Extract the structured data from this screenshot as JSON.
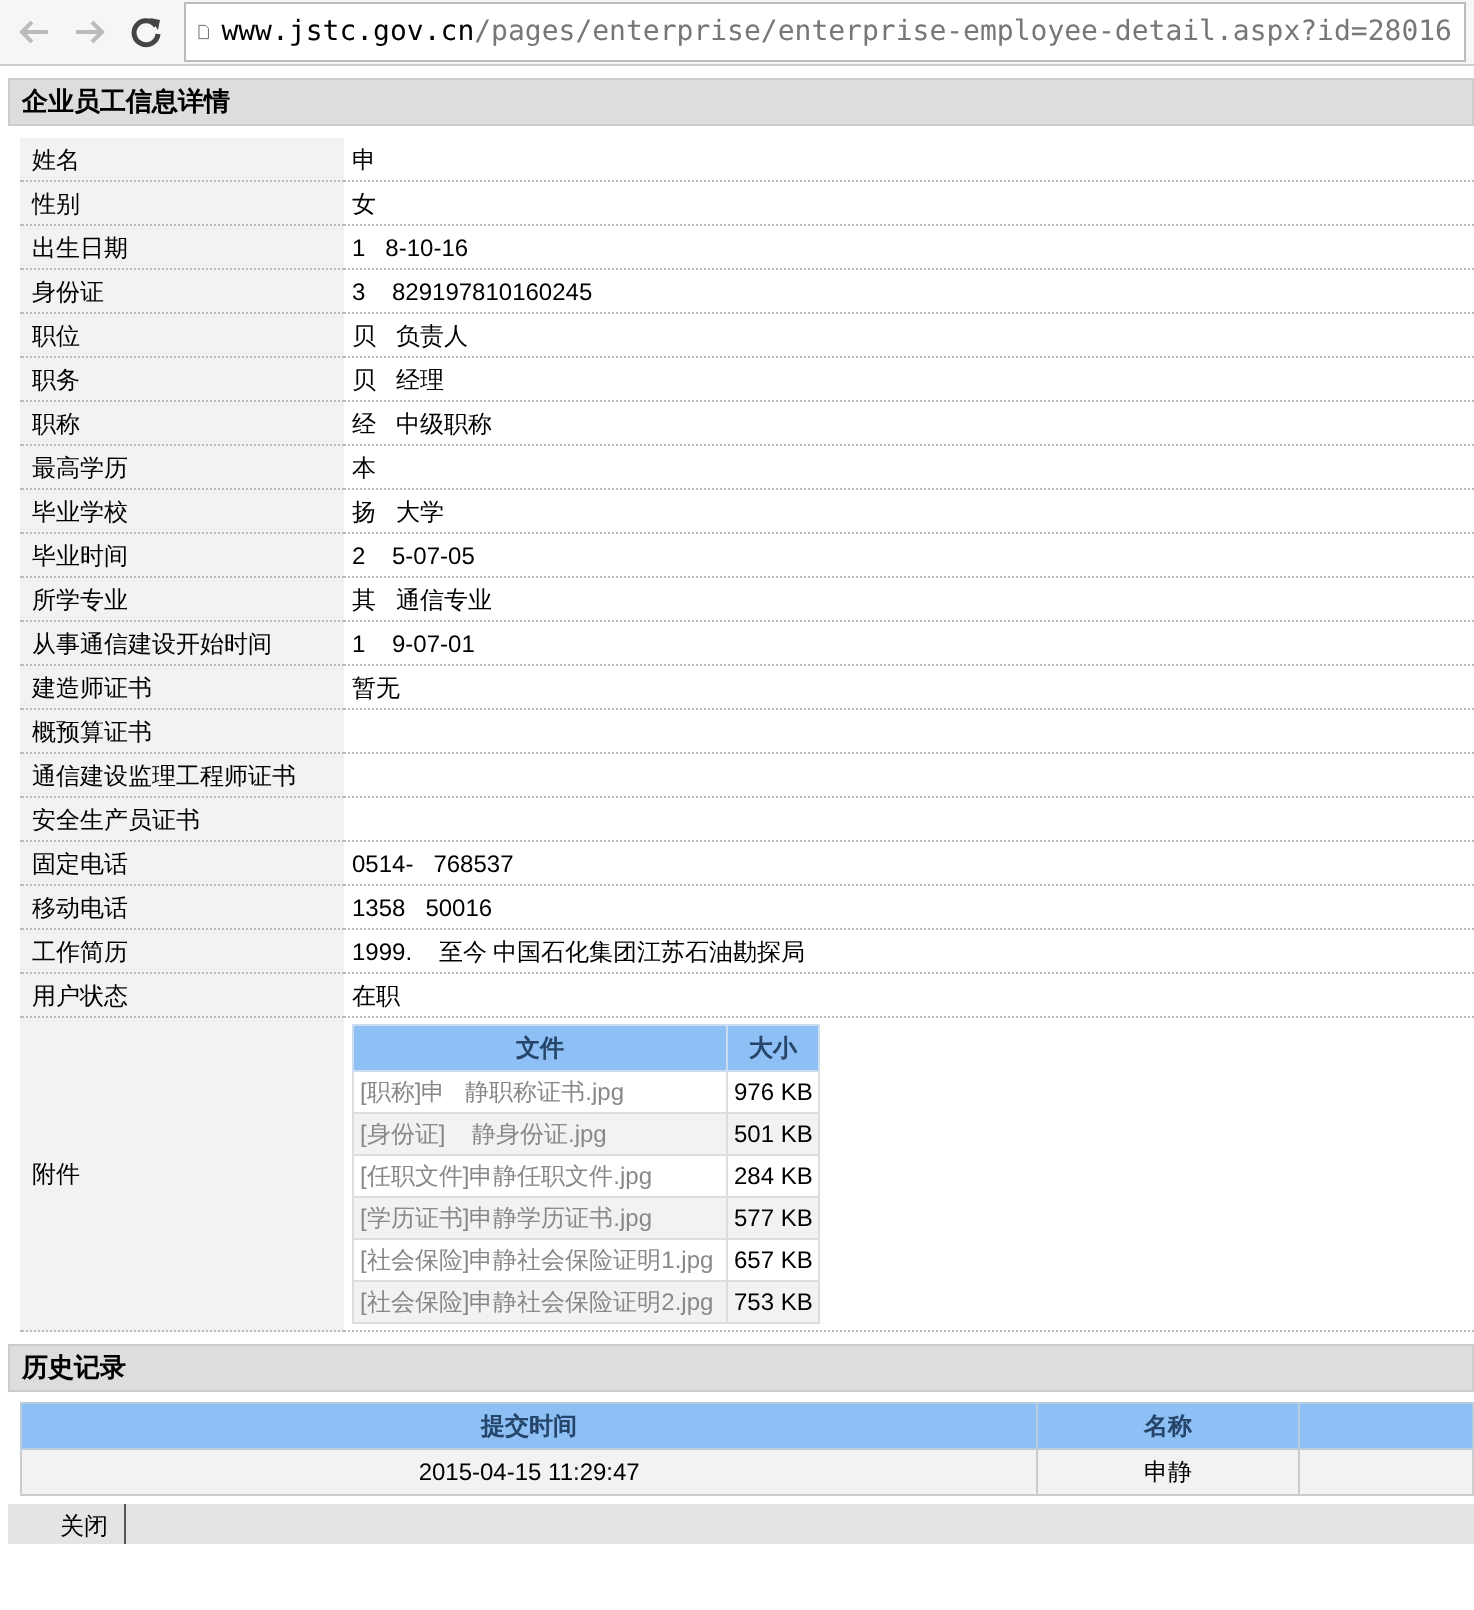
{
  "browser": {
    "url_host": "www.jstc.gov.cn",
    "url_path": "/pages/enterprise/enterprise-employee-detail.aspx?id=28016"
  },
  "detail": {
    "title": "企业员工信息详情",
    "fields": [
      {
        "label": "姓名",
        "value": "申"
      },
      {
        "label": "性别",
        "value": "女"
      },
      {
        "label": "出生日期",
        "value": "1   8-10-16"
      },
      {
        "label": "身份证",
        "value": "3    829197810160245"
      },
      {
        "label": "职位",
        "value": "贝   负责人"
      },
      {
        "label": "职务",
        "value": "贝   经理"
      },
      {
        "label": "职称",
        "value": "经   中级职称"
      },
      {
        "label": "最高学历",
        "value": "本"
      },
      {
        "label": "毕业学校",
        "value": "扬   大学"
      },
      {
        "label": "毕业时间",
        "value": "2    5-07-05"
      },
      {
        "label": "所学专业",
        "value": "其   通信专业"
      },
      {
        "label": "从事通信建设开始时间",
        "value": "1    9-07-01"
      },
      {
        "label": "建造师证书",
        "value": "暂无"
      },
      {
        "label": "概预算证书"
      },
      {
        "label": "通信建设监理工程师证书"
      },
      {
        "label": "安全生产员证书"
      },
      {
        "label": "固定电话",
        "value": "0514-   768537"
      },
      {
        "label": "移动电话",
        "value": "1358   50016"
      },
      {
        "label": "工作简历",
        "value": "1999.    至今 中国石化集团江苏石油勘探局"
      },
      {
        "label": "用户状态",
        "value": "在职"
      }
    ],
    "attachments": {
      "label": "附件",
      "columns": [
        "文件",
        "大小"
      ],
      "rows": [
        {
          "file": "[职称]申   静职称证书.jpg",
          "size": "976 KB"
        },
        {
          "file": "[身份证]    静身份证.jpg",
          "size": "501 KB"
        },
        {
          "file": "[任职文件]申静任职文件.jpg",
          "size": "284 KB"
        },
        {
          "file": "[学历证书]申静学历证书.jpg",
          "size": "577 KB"
        },
        {
          "file": "[社会保险]申静社会保险证明1.jpg",
          "size": "657 KB"
        },
        {
          "file": "[社会保险]申静社会保险证明2.jpg",
          "size": "753 KB"
        }
      ]
    }
  },
  "history": {
    "title": "历史记录",
    "columns": [
      "提交时间",
      "名称"
    ],
    "rows": [
      {
        "time": "2015-04-15 11:29:47",
        "name": "申静"
      }
    ]
  },
  "footer": {
    "button": "关闭"
  }
}
